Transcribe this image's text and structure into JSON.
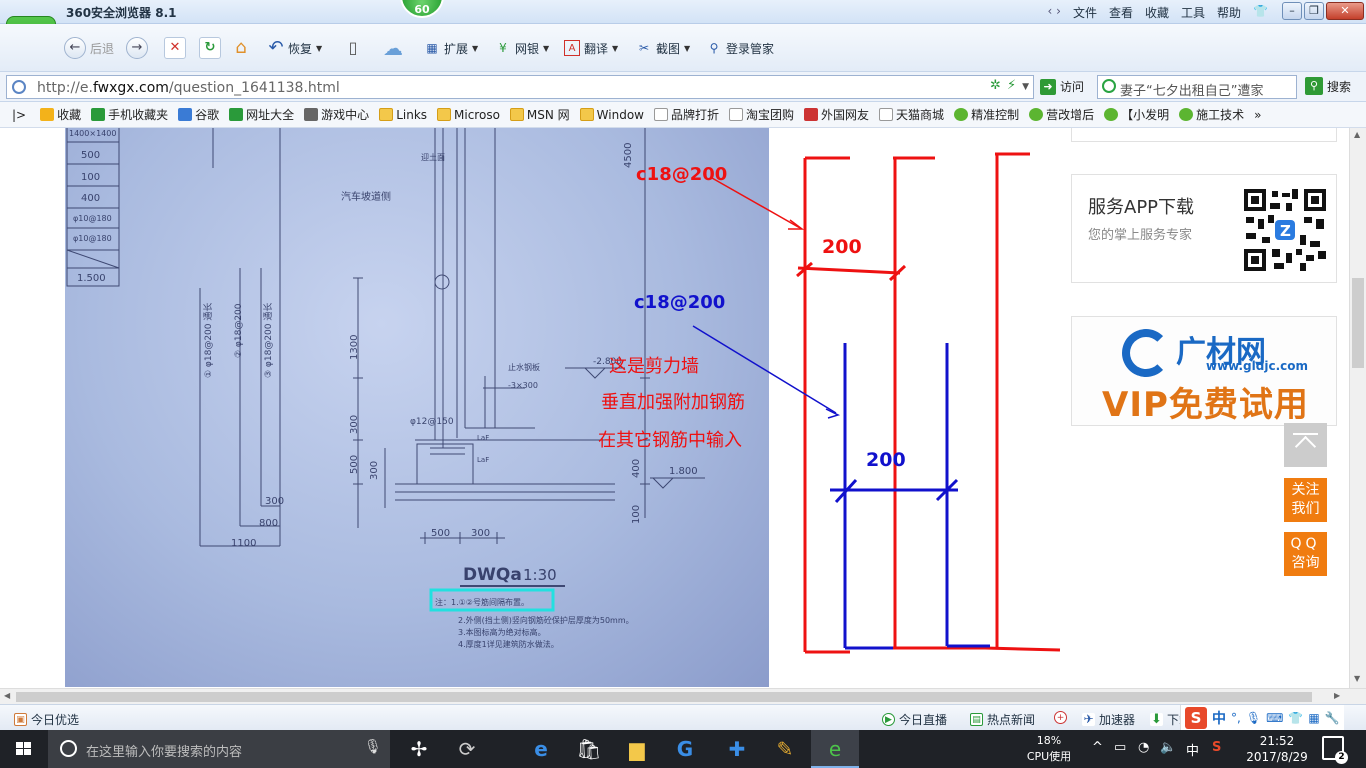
{
  "window": {
    "title": "360安全浏览器 8.1",
    "badge": "60",
    "menu": [
      "文件",
      "查看",
      "收藏",
      "工具",
      "帮助"
    ]
  },
  "toolbar": {
    "back": "后退",
    "restore": "恢复",
    "extend": "扩展",
    "bank": "网银",
    "translate": "翻译",
    "screenshot": "截图",
    "login_manager": "登录管家"
  },
  "address": {
    "url_prefix": "http://e.",
    "url_domain": "fwxgx.com",
    "url_path": "/question_1641138.html",
    "visit": "访问",
    "search_query": "妻子“七夕出租自己”遭家",
    "search_button": "搜索"
  },
  "bookmarks": [
    {
      "label": "收藏",
      "icon": "star-icon"
    },
    {
      "label": "手机收藏夹",
      "icon": "phone-icon"
    },
    {
      "label": "谷歌",
      "icon": "google-icon"
    },
    {
      "label": "网址大全",
      "icon": "globe-icon"
    },
    {
      "label": "游戏中心",
      "icon": "gamepad-icon"
    },
    {
      "label": "Links",
      "icon": "folder-icon"
    },
    {
      "label": "Microso",
      "icon": "folder-icon"
    },
    {
      "label": "MSN 网",
      "icon": "folder-icon"
    },
    {
      "label": "Window",
      "icon": "folder-icon"
    },
    {
      "label": "品牌打折",
      "icon": "page-icon"
    },
    {
      "label": "淘宝团购",
      "icon": "page-icon"
    },
    {
      "label": "外国网友",
      "icon": "flag-icon"
    },
    {
      "label": "天猫商城",
      "icon": "page-icon"
    },
    {
      "label": "精准控制",
      "icon": "chat-icon"
    },
    {
      "label": "营改增后",
      "icon": "chat-icon"
    },
    {
      "label": "【小发明",
      "icon": "chat-icon"
    },
    {
      "label": "施工技术",
      "icon": "chat-icon"
    }
  ],
  "drawing": {
    "rebar_table": [
      "1400×1400",
      "500",
      "100",
      "400",
      "φ10@180",
      "φ10@180",
      "1.500"
    ],
    "vertical_labels": [
      "① φ18@200 通长",
      "② φ18@200",
      "③ φ18@200 通长"
    ],
    "dims": [
      "4500",
      "1300",
      "300",
      "500",
      "300",
      "400",
      "100",
      "300",
      "800",
      "1100",
      "500",
      "300"
    ],
    "elevations": [
      "-2.800",
      "1.800"
    ],
    "notes_top": [
      "迎土面",
      "汽车坡道侧",
      "止水钢板",
      "-3×300",
      "φ12@150",
      "LaF",
      "LaF"
    ],
    "section_title": "DWQa",
    "section_scale": "1:30",
    "notes": [
      "注：1.①②号筋间隔布置。",
      "2.外侧(挡土侧)竖向钢筋砼保护层厚度为50mm。",
      "3.本图标高为绝对标高。",
      "4.厚度1详见建筑防水做法。"
    ]
  },
  "annotations": {
    "red_label": "c18@200",
    "red_dim": "200",
    "blue_label": "c18@200",
    "blue_dim": "200",
    "note_line1": "这是剪力墙",
    "note_line2": "垂直加强附加钢筋",
    "note_line3": "在其它钢筋中输入",
    "red_color": "#ee1111",
    "blue_color": "#1111cc"
  },
  "sidebar": {
    "app_title": "服务APP下载",
    "app_sub": "您的掌上服务专家",
    "ad_brand": "广材网",
    "ad_url": "www.gldjc.com",
    "ad_vip": "VIP免费试用",
    "contact": "关注我们",
    "contact_l1": "关注",
    "contact_l2": "我们",
    "qq_l1": "QQ",
    "qq_l2": "咨询"
  },
  "statusbar": {
    "today": "今日优选",
    "live": "今日直播",
    "hot_news": "热点新闻",
    "accelerator": "加速器",
    "download": "下载",
    "ime_lang": "中"
  },
  "taskbar": {
    "search_placeholder": "在这里输入你要搜索的内容",
    "cpu_percent": "18%",
    "cpu_label": "CPU使用",
    "ime": "中",
    "time": "21:52",
    "date": "2017/8/29",
    "notifications": "2"
  }
}
